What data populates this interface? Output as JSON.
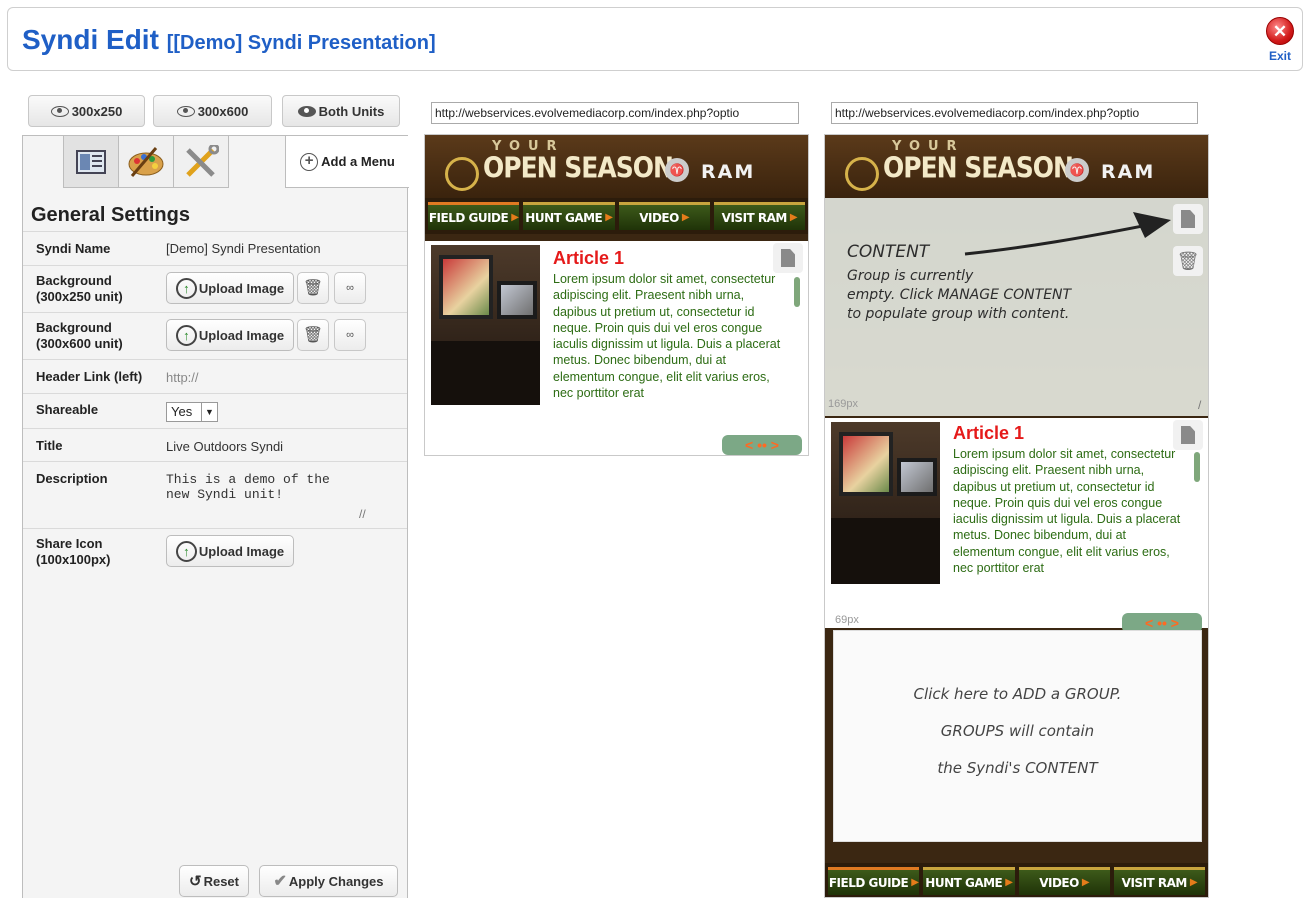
{
  "header": {
    "app_name": "Syndi Edit",
    "doc_title": "[[Demo] Syndi Presentation]",
    "exit_label": "Exit"
  },
  "unit_buttons": [
    {
      "label": "300x250"
    },
    {
      "label": "300x600"
    },
    {
      "label": "Both Units"
    }
  ],
  "panel": {
    "tabs": [
      {
        "icon": "layout-icon"
      },
      {
        "icon": "palette-icon"
      },
      {
        "icon": "tools-icon"
      }
    ],
    "add_menu_label": "Add a Menu",
    "section_title": "General Settings",
    "fields": {
      "syndi_name": {
        "label": "Syndi Name",
        "value": "[Demo] Syndi Presentation"
      },
      "bg_250": {
        "label_line1": "Background",
        "label_line2": "(300x250 unit)",
        "button": "Upload Image"
      },
      "bg_600": {
        "label_line1": "Background",
        "label_line2": "(300x600 unit)",
        "button": "Upload Image"
      },
      "header_link": {
        "label": "Header Link (left)",
        "placeholder": "http://"
      },
      "shareable": {
        "label": "Shareable",
        "value": "Yes"
      },
      "title": {
        "label": "Title",
        "value": "Live Outdoors Syndi"
      },
      "description": {
        "label": "Description",
        "value": "This is a demo of the\nnew Syndi unit!"
      },
      "share_icon": {
        "label_line1": "Share Icon",
        "label_line2": "(100x100px)",
        "button": "Upload Image"
      }
    },
    "reset_label": "Reset",
    "apply_label": "Apply Changes"
  },
  "previews": {
    "url": "http://webservices.evolvemediacorp.com/index.php?optio",
    "banner": {
      "your": "YOUR",
      "season": "OPEN SEASON",
      "brand": "RAM"
    },
    "nav": [
      "FIELD GUIDE",
      "HUNT GAME",
      "VIDEO",
      "VISIT RAM"
    ],
    "article": {
      "title": "Article 1",
      "body": "Lorem ipsum dolor sit amet, consectetur adipiscing elit. Praesent nibh urna, dapibus ut pretium ut, consectetur id neque. Proin quis dui vel eros congue iaculis dignissim ut ligula. Duis a placerat metus. Donec bibendum, dui at elementum congue, elit elit varius eros, nec porttitor erat"
    },
    "pager": "< •• >",
    "content_note": {
      "heading": "CONTENT",
      "line1": "Group is currently",
      "line2": "empty. Click MANAGE CONTENT",
      "line3": "to populate group with content."
    },
    "height_169": "169px",
    "height_69": "69px",
    "add_group": {
      "line1": "Click here to ADD a GROUP.",
      "line2": "GROUPS will contain",
      "line3": "the Syndi's CONTENT"
    }
  },
  "colors": {
    "brand_blue": "#1f5fc6",
    "article_red": "#e51a1a",
    "article_green": "#2d6c14",
    "pager_bg": "#7ca886"
  }
}
